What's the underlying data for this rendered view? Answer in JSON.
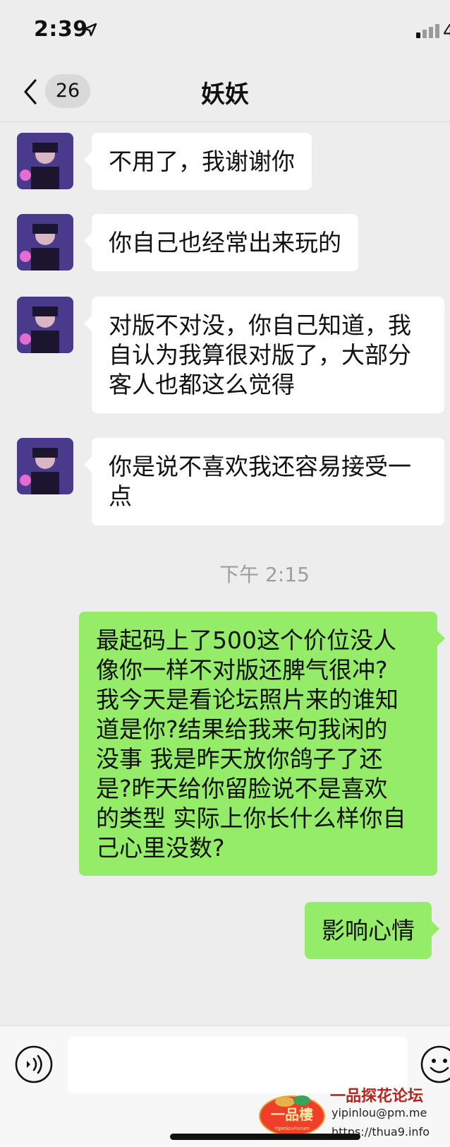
{
  "status_bar": {
    "time": "2:39",
    "battery": "4"
  },
  "header": {
    "unread_count": "26",
    "title": "妖妖"
  },
  "messages": [
    {
      "side": "in",
      "lines": [
        "不用了，我谢谢你"
      ]
    },
    {
      "side": "in",
      "lines": [
        "你自己也经常出来玩的"
      ]
    },
    {
      "side": "in",
      "lines": [
        "对版不对没，你自己知道，我",
        "自认为我算很对版了，大部分",
        "客人也都这么觉得"
      ]
    },
    {
      "side": "in",
      "lines": [
        "你是说不喜欢我还容易接受一",
        "点"
      ]
    },
    {
      "side": "out",
      "lines": [
        "最起码上了500这个价位没人",
        "像你一样不对版还脾气很冲?",
        "我今天是看论坛照片来的谁知",
        "道是你?结果给我来句我闲的",
        "没事 我是昨天放你鸽子了还",
        "是?昨天给你留脸说不是喜欢",
        "的类型 实际上你长什么样你自",
        "己心里没数?"
      ]
    },
    {
      "side": "out",
      "lines": [
        "影响心情"
      ]
    }
  ],
  "timestamp": "下午 2:15",
  "input_bar": {
    "placeholder": ""
  },
  "watermark": {
    "logo_text": "一品樓",
    "logo_subtext": "YipinlouForum",
    "title": "一品探花论坛",
    "email": "yipinlou@pm.me",
    "url": "https://thua9.info"
  },
  "colors": {
    "background": "#ededed",
    "outgoing_bubble": "#95ec69",
    "incoming_bubble": "#ffffff",
    "watermark_red": "#b5261e"
  }
}
